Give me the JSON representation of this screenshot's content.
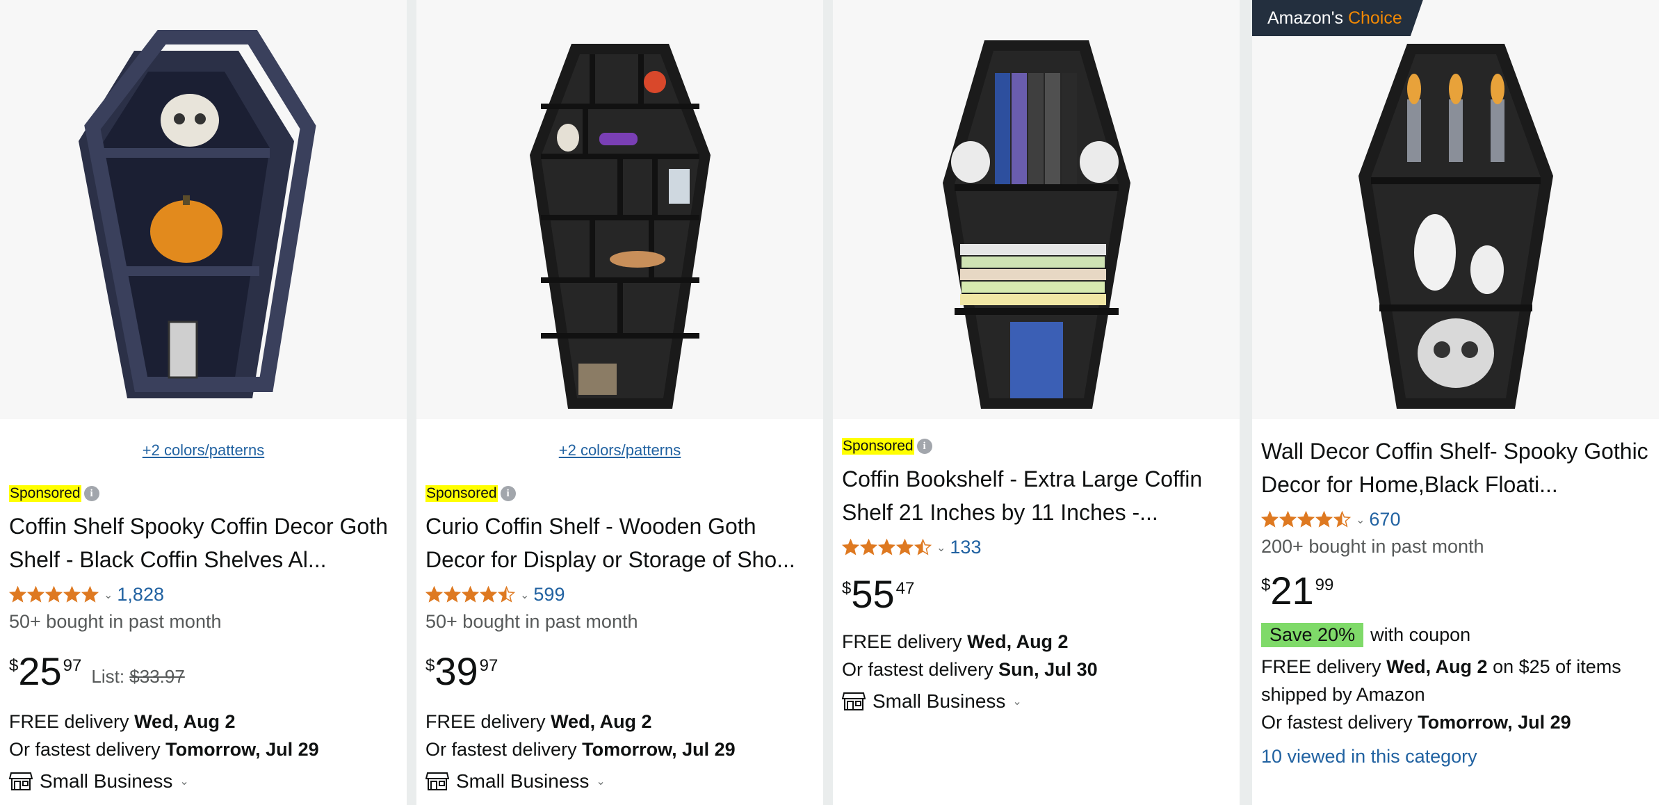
{
  "products": [
    {
      "colors_link": "+2 colors/patterns",
      "sponsored": "Sponsored",
      "title": "Coffin Shelf Spooky Coffin Decor Goth Shelf - Black Coffin Shelves Al...",
      "rating": 5.0,
      "rating_count": "1,828",
      "bought": "50+ bought in past month",
      "price_symbol": "$",
      "price_whole": "25",
      "price_fraction": "97",
      "list_label": "List:",
      "list_price": "$33.97",
      "delivery_prefix": "FREE delivery",
      "delivery_date": "Wed, Aug 2",
      "fastest_prefix": "Or fastest delivery",
      "fastest_date": "Tomorrow, Jul 29",
      "small_business": "Small Business"
    },
    {
      "colors_link": "+2 colors/patterns",
      "sponsored": "Sponsored",
      "title": "Curio Coffin Shelf - Wooden Goth Decor for Display or Storage of Sho...",
      "rating": 4.5,
      "rating_count": "599",
      "bought": "50+ bought in past month",
      "price_symbol": "$",
      "price_whole": "39",
      "price_fraction": "97",
      "delivery_prefix": "FREE delivery",
      "delivery_date": "Wed, Aug 2",
      "fastest_prefix": "Or fastest delivery",
      "fastest_date": "Tomorrow, Jul 29",
      "small_business": "Small Business"
    },
    {
      "sponsored": "Sponsored",
      "title": "Coffin Bookshelf - Extra Large Coffin Shelf 21 Inches by 11 Inches -...",
      "rating": 4.5,
      "rating_count": "133",
      "price_symbol": "$",
      "price_whole": "55",
      "price_fraction": "47",
      "delivery_prefix": "FREE delivery",
      "delivery_date": "Wed, Aug 2",
      "fastest_prefix": "Or fastest delivery",
      "fastest_date": "Sun, Jul 30",
      "small_business": "Small Business"
    },
    {
      "badge_prefix": "Amazon's",
      "badge_choice": "Choice",
      "title": "Wall Decor Coffin Shelf- Spooky Gothic Decor for Home,Black Floati...",
      "rating": 4.5,
      "rating_count": "670",
      "bought": "200+ bought in past month",
      "price_symbol": "$",
      "price_whole": "21",
      "price_fraction": "99",
      "coupon_badge": "Save 20%",
      "coupon_text": "with coupon",
      "delivery_prefix": "FREE delivery",
      "delivery_date": "Wed, Aug 2",
      "delivery_suffix": "on $25 of items shipped by Amazon",
      "fastest_prefix": "Or fastest delivery",
      "fastest_date": "Tomorrow, Jul 29",
      "viewed": "10 viewed in this category"
    }
  ],
  "colors": {
    "link": "#2162a1",
    "star": "#de7921",
    "sponsored_highlight": "#ffff00",
    "coupon_badge": "#7fda69",
    "badge_bg": "#232f3e",
    "badge_accent": "#f08804"
  },
  "icons": {
    "info": "info-icon",
    "chevron": "chevron-down-icon",
    "star": "star-icon",
    "store": "store-icon"
  }
}
